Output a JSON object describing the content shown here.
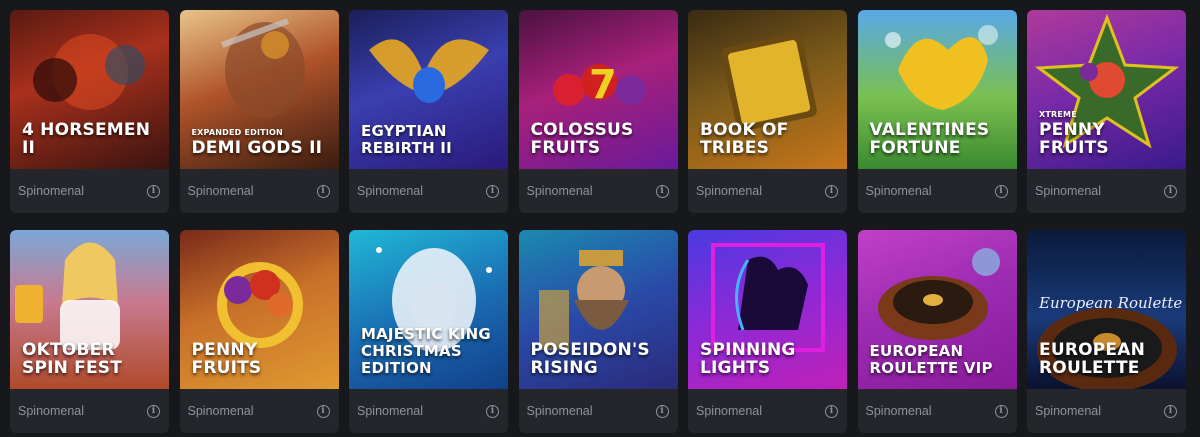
{
  "games": [
    {
      "title": "4 HorsemeN II",
      "provider": "Spinomenal",
      "bg": "linear-gradient(160deg,#5a1a12 0%,#a8301c 40%,#3a1410 100%)",
      "accent": "#e04a20"
    },
    {
      "title": "Demi Gods II",
      "subtitle": "Expanded Edition",
      "provider": "Spinomenal",
      "bg": "linear-gradient(160deg,#e8c48a 0%,#b0542a 45%,#3a1c10 100%)",
      "accent": "#d8902a"
    },
    {
      "title": "Egyptian Rebirth II",
      "provider": "Spinomenal",
      "bg": "linear-gradient(160deg,#1a1f5a 0%,#3a3fb0 45%,#2a1a7a 100%)",
      "accent": "#e8a820"
    },
    {
      "title": "Colossus Fruits",
      "provider": "Spinomenal",
      "bg": "linear-gradient(160deg,#4a1240 0%,#a8207a 45%,#6a1a9a 100%)",
      "accent": "#d82030"
    },
    {
      "title": "Book of Tribes",
      "provider": "Spinomenal",
      "bg": "linear-gradient(160deg,#3a2a12 0%,#7a5a1a 45%,#c8761a 100%)",
      "accent": "#f0c030"
    },
    {
      "title": "Valentines Fortune",
      "provider": "Spinomenal",
      "bg": "linear-gradient(180deg,#58a8e8 0%,#7ac050 55%,#3a8a30 100%)",
      "accent": "#f0c020"
    },
    {
      "title": "Penny Fruits",
      "subtitle": "Xtreme",
      "provider": "Spinomenal",
      "bg": "linear-gradient(160deg,#b03a9a 0%,#7a2aa8 45%,#3a1a8a 100%)",
      "accent": "#e0c020"
    },
    {
      "title": "Oktober Spin Fest",
      "provider": "Spinomenal",
      "bg": "linear-gradient(180deg,#7aa8d8 0%,#c87a90 45%,#b04a2a 100%)",
      "accent": "#f0c860"
    },
    {
      "title": "Penny Fruits",
      "provider": "Spinomenal",
      "bg": "linear-gradient(160deg,#7a2a1a 0%,#c8702a 45%,#e09a30 100%)",
      "accent": "#f0c030"
    },
    {
      "title": "Majestic King Christmas Edition",
      "provider": "Spinomenal",
      "bg": "linear-gradient(160deg,#20b8d8 0%,#1a6ab0 55%,#12408a 100%)",
      "accent": "#e8f0f8"
    },
    {
      "title": "Poseidon's Rising",
      "provider": "Spinomenal",
      "bg": "linear-gradient(160deg,#1a8ab0 0%,#2a4aa8 50%,#2a2a7a 100%)",
      "accent": "#c89a40"
    },
    {
      "title": "Spinning Lights",
      "provider": "Spinomenal",
      "bg": "linear-gradient(160deg,#4a3ae0 0%,#8a2ad8 45%,#c020b8 100%)",
      "accent": "#e020e0"
    },
    {
      "title": "European Roulette VIP",
      "provider": "Spinomenal",
      "bg": "linear-gradient(160deg,#c040c8 0%,#9a2ab0 50%,#8a1a9a 100%)",
      "accent": "#7a3a1a"
    },
    {
      "title": "European Roulette",
      "provider": "Spinomenal",
      "bg": "linear-gradient(180deg,#0a1a3a 0%,#1a3a7a 55%,#0a1230 100%)",
      "accent": "#c88a2a"
    }
  ],
  "icons": {
    "info": "info-icon"
  }
}
